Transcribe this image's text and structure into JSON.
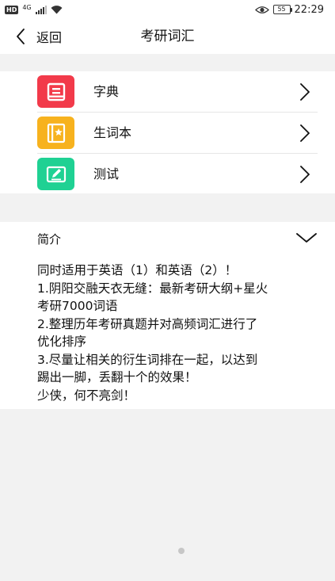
{
  "status_bar": {
    "hd": "HD",
    "network": "4G",
    "battery": "55",
    "time": "22:29"
  },
  "header": {
    "back_label": "返回",
    "title": "考研词汇"
  },
  "menu": {
    "items": [
      {
        "label": "字典",
        "icon": "dictionary-icon",
        "color": "#f23a4a"
      },
      {
        "label": "生词本",
        "icon": "vocabulary-book-icon",
        "color": "#f7b21e"
      },
      {
        "label": "测试",
        "icon": "test-edit-icon",
        "color": "#1fd193"
      }
    ]
  },
  "intro": {
    "title": "简介",
    "text": "同时适用于英语（1）和英语（2）！\n1.阴阳交融天衣无缝：最新考研大纲+星火\n考研7000词语\n2.整理历年考研真题并对高频词汇进行了\n优化排序\n3.尽量让相关的衍生词排在一起，以达到\n踢出一脚，丢翻十个的效果！\n少侠，何不亮剑！"
  },
  "colors": {
    "background": "#f2f2f2",
    "card": "#ffffff",
    "dictionary": "#f23a4a",
    "vocabulary": "#f7b21e",
    "test": "#1fd193"
  }
}
